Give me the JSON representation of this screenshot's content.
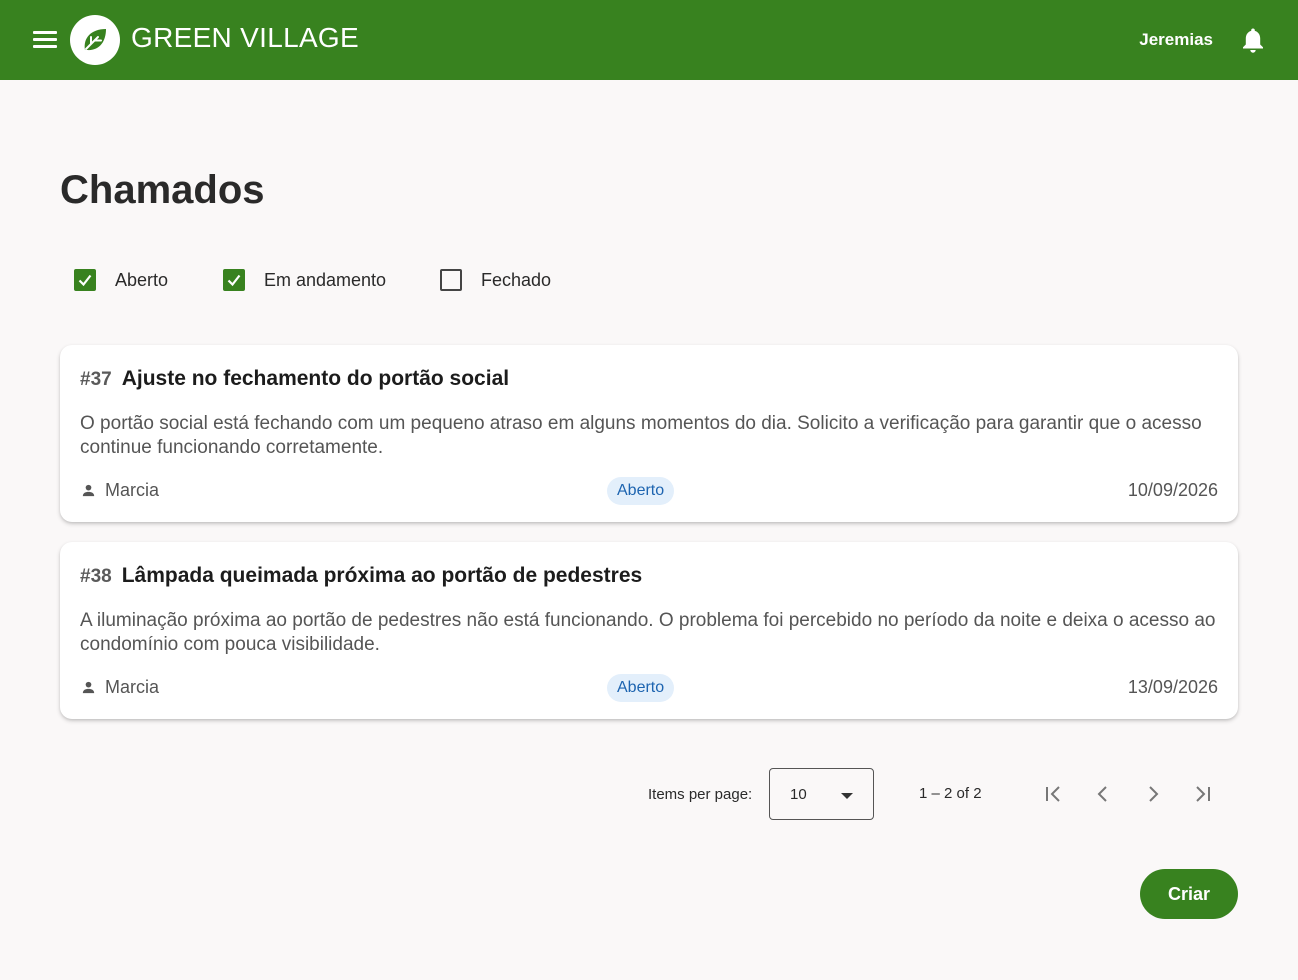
{
  "header": {
    "brand": "GREEN VILLAGE",
    "user": "Jeremias",
    "icons": [
      "menu-icon",
      "leaf-logo-icon",
      "bell-icon"
    ]
  },
  "page": {
    "title": "Chamados"
  },
  "filters": [
    {
      "label": "Aberto",
      "checked": true
    },
    {
      "label": "Em andamento",
      "checked": true
    },
    {
      "label": "Fechado",
      "checked": false
    }
  ],
  "tickets": [
    {
      "number": "#37",
      "title": "Ajuste no fechamento do portão social",
      "description": "O portão social está fechando com um pequeno atraso em alguns momentos do dia. Solicito a verificação para garantir que o acesso continue funcionando corretamente.",
      "author": "Marcia",
      "status": "Aberto",
      "date": "10/09/2026"
    },
    {
      "number": "#38",
      "title": "Lâmpada queimada próxima ao portão de pedestres",
      "description": "A iluminação próxima ao portão de pedestres não está funcionando. O problema foi percebido no período da noite e deixa o acesso ao condomínio com pouca visibilidade.",
      "author": "Marcia",
      "status": "Aberto",
      "date": "13/09/2026"
    }
  ],
  "paginator": {
    "items_per_page_label": "Items per page:",
    "items_per_page": "10",
    "range": "1 – 2 of 2",
    "icons": [
      "first-page-icon",
      "prev-page-icon",
      "next-page-icon",
      "last-page-icon"
    ]
  },
  "actions": {
    "create_label": "Criar"
  },
  "colors": {
    "primary": "#38821f",
    "badge_bg": "#e3effb",
    "badge_text": "#1d64b0",
    "background": "#faf8f8"
  }
}
